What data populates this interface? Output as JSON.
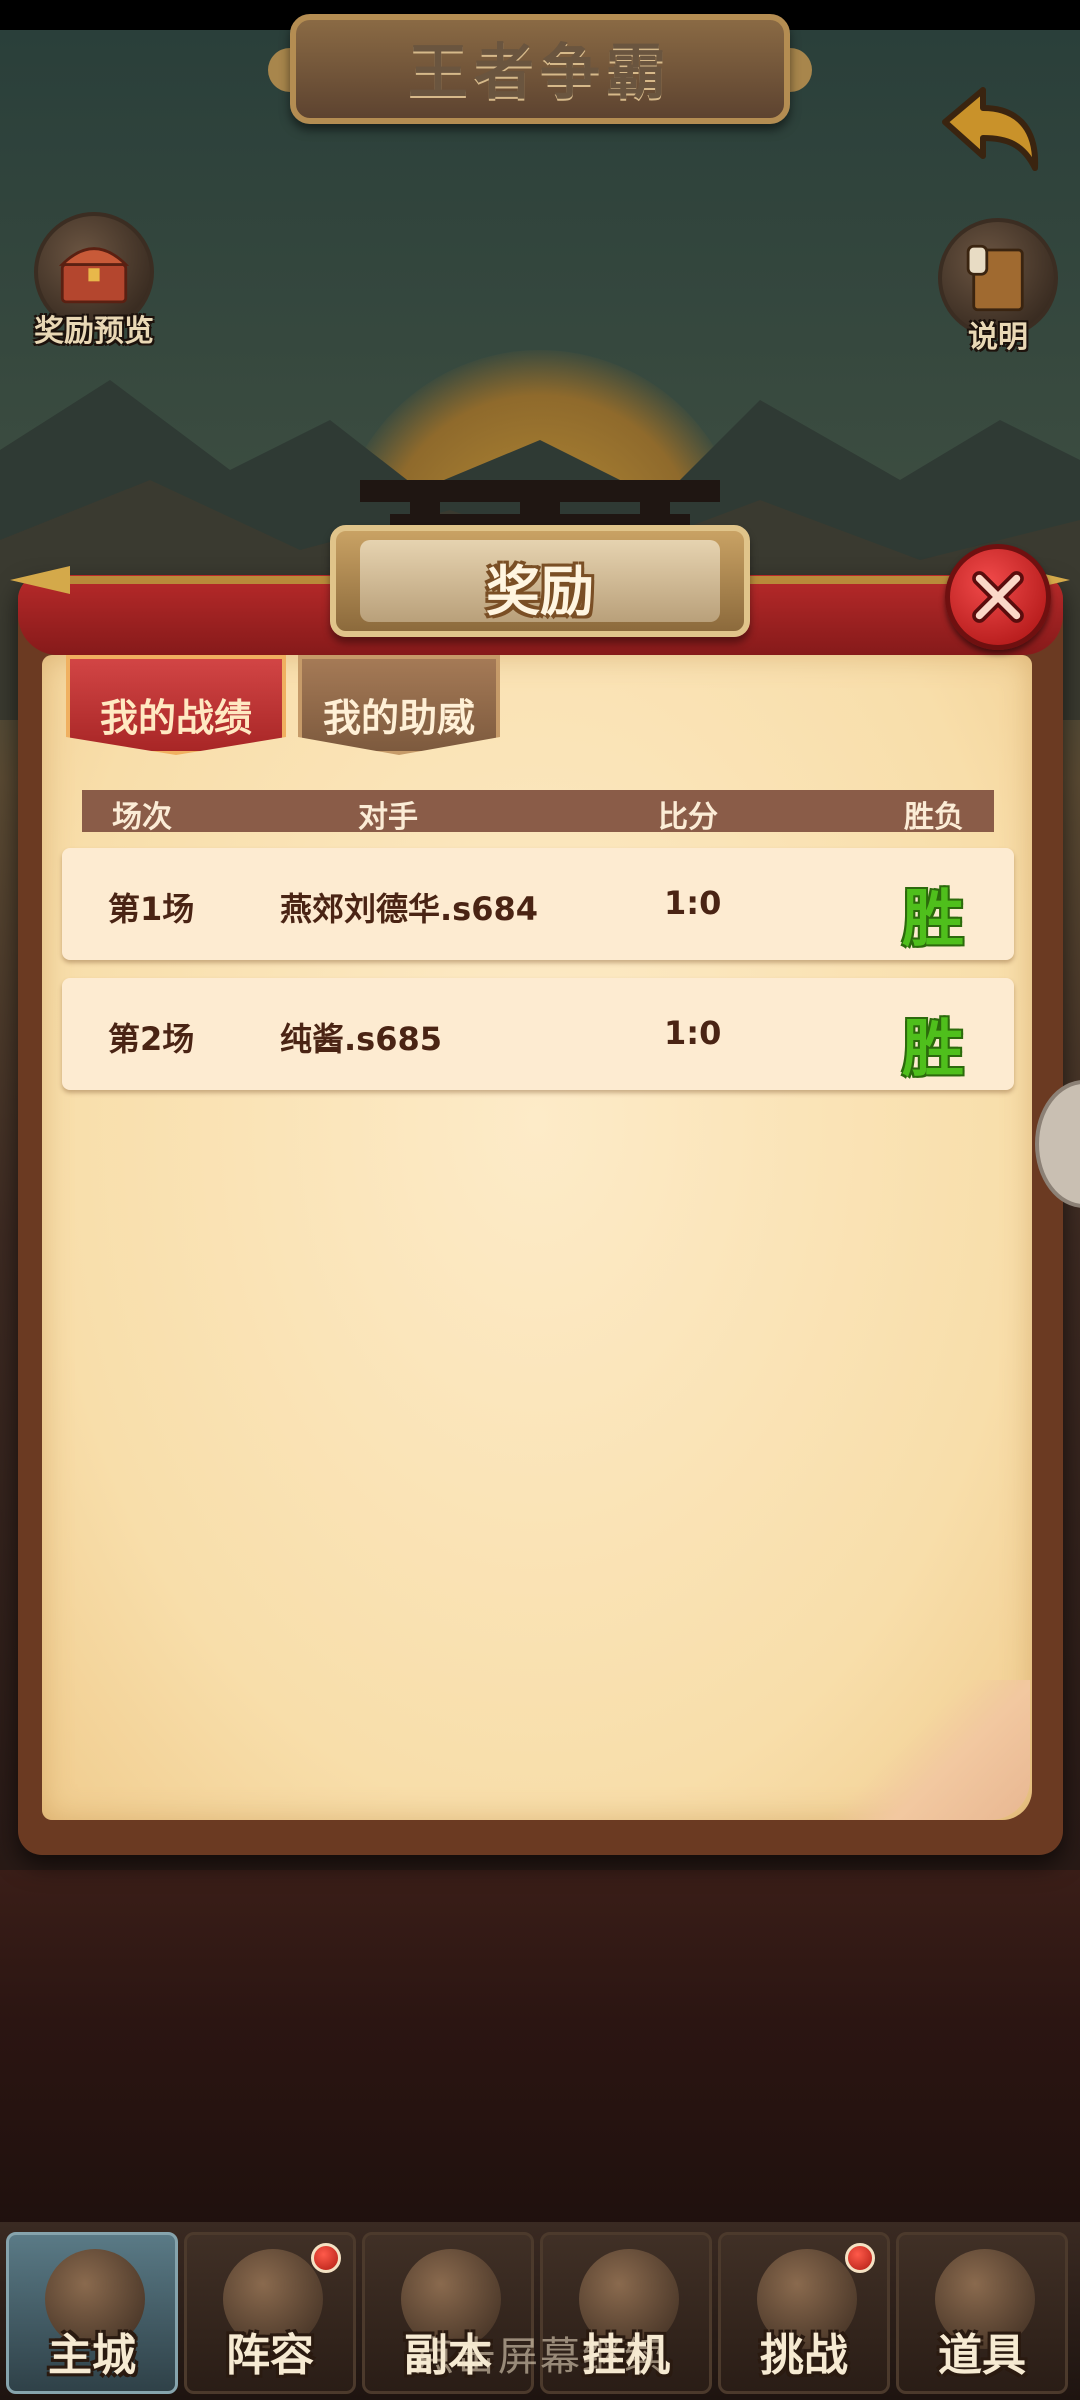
{
  "header": {
    "title": "王者争霸"
  },
  "side_buttons": {
    "reward_preview": "奖励预览",
    "instructions": "说明"
  },
  "modal": {
    "title": "奖励",
    "tabs": [
      {
        "label": "我的战绩",
        "active": true
      },
      {
        "label": "我的助威",
        "active": false
      }
    ],
    "table": {
      "columns": [
        "场次",
        "对手",
        "比分",
        "胜负"
      ],
      "rows": [
        {
          "round": "第1场",
          "opponent": "燕郊刘德华.s684",
          "score": "1:0",
          "result": "胜"
        },
        {
          "round": "第2场",
          "opponent": "纯酱.s685",
          "score": "1:0",
          "result": "胜"
        }
      ]
    }
  },
  "bottom_nav": [
    {
      "label": "主城",
      "icon": "castle-icon",
      "active": true,
      "badge": false
    },
    {
      "label": "阵容",
      "icon": "formation-icon",
      "active": false,
      "badge": true
    },
    {
      "label": "副本",
      "icon": "dungeon-icon",
      "active": false,
      "badge": false
    },
    {
      "label": "挂机",
      "icon": "idle-icon",
      "active": false,
      "badge": false
    },
    {
      "label": "挑战",
      "icon": "challenge-icon",
      "active": false,
      "badge": true
    },
    {
      "label": "道具",
      "icon": "items-icon",
      "active": false,
      "badge": false
    }
  ],
  "hint": "点击屏幕继续",
  "colors": {
    "win": "#4fbf1c",
    "accent_red": "#c0302f",
    "paper": "#fbe5bd"
  }
}
